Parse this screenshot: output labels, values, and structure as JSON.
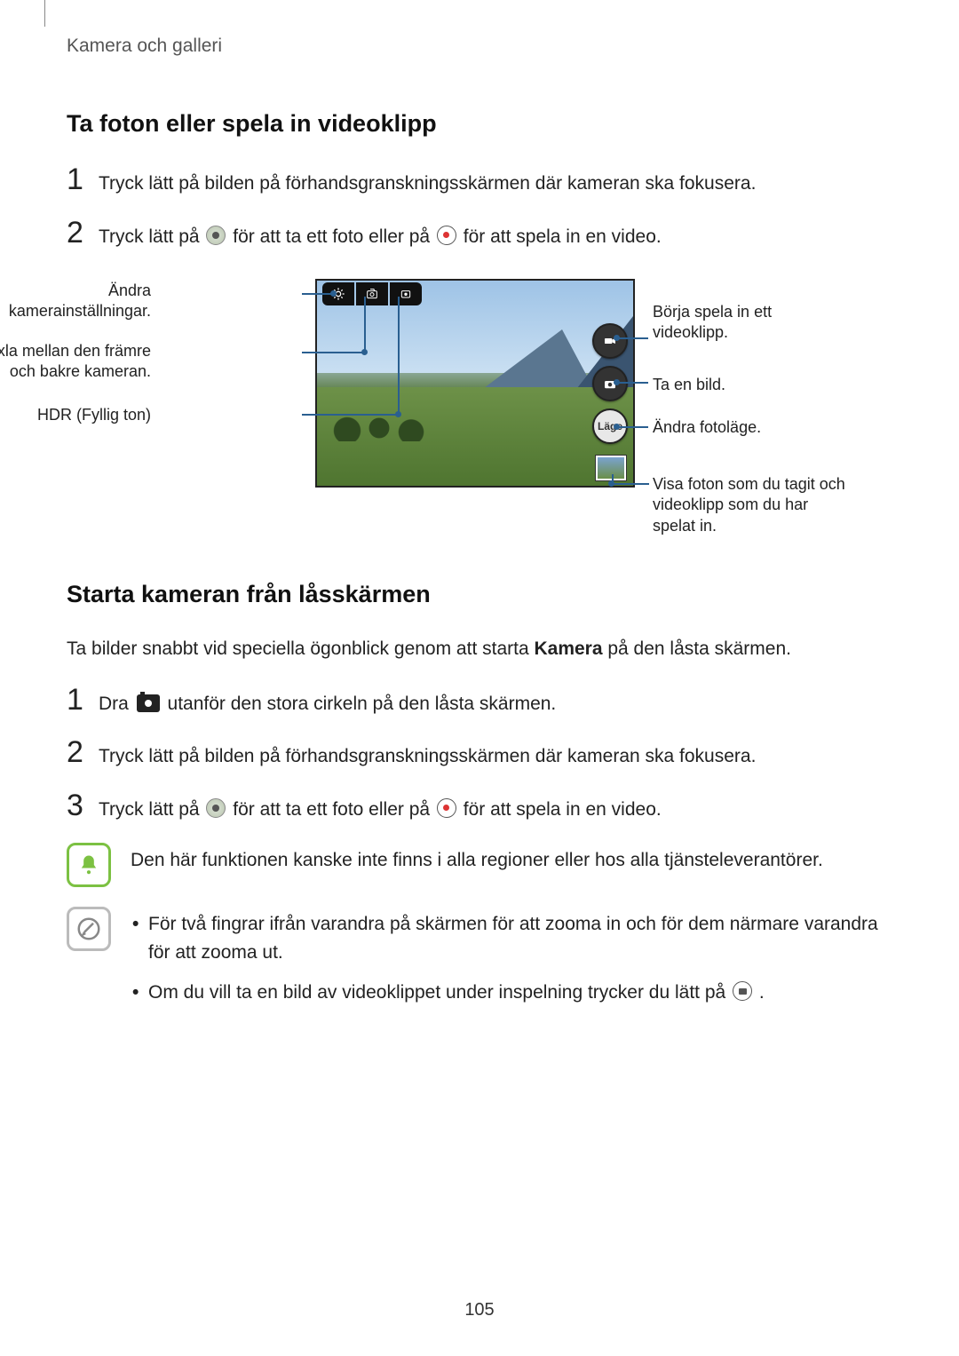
{
  "breadcrumb": "Kamera och galleri",
  "section1": {
    "title": "Ta foton eller spela in videoklipp",
    "step1": {
      "num": "1",
      "text": "Tryck lätt på bilden på förhandsgranskningsskärmen där kameran ska fokusera."
    },
    "step2": {
      "num": "2",
      "text_a": "Tryck lätt på ",
      "text_b": " för att ta ett foto eller på ",
      "text_c": " för att spela in en video."
    }
  },
  "diagram": {
    "left": {
      "settings": "Ändra kamerainställningar.",
      "switch": "Växla mellan den främre och bakre kameran.",
      "hdr": "HDR (Fyllig ton)"
    },
    "right": {
      "record": "Börja spela in ett videoklipp.",
      "shot": "Ta en bild.",
      "mode": "Ändra fotoläge.",
      "gallery": "Visa foton som du tagit och videoklipp som du har spelat in."
    },
    "mode_btn_label": "Läge"
  },
  "section2": {
    "title": "Starta kameran från låsskärmen",
    "intro_a": "Ta bilder snabbt vid speciella ögonblick genom att starta ",
    "intro_strong": "Kamera",
    "intro_b": " på den låsta skärmen.",
    "step1": {
      "num": "1",
      "text_a": "Dra ",
      "text_b": " utanför den stora cirkeln på den låsta skärmen."
    },
    "step2": {
      "num": "2",
      "text": "Tryck lätt på bilden på förhandsgranskningsskärmen där kameran ska fokusera."
    },
    "step3": {
      "num": "3",
      "text_a": "Tryck lätt på ",
      "text_b": " för att ta ett foto eller på ",
      "text_c": " för att spela in en video."
    }
  },
  "notes": {
    "region": "Den här funktionen kanske inte finns i alla regioner eller hos alla tjänsteleverantörer.",
    "zoom": "För två fingrar ifrån varandra på skärmen för att zooma in och för dem närmare varandra för att zooma ut.",
    "snap_during_video_a": "Om du vill ta en bild av videoklippet under inspelning trycker du lätt på ",
    "snap_during_video_b": "."
  },
  "page_number": "105"
}
